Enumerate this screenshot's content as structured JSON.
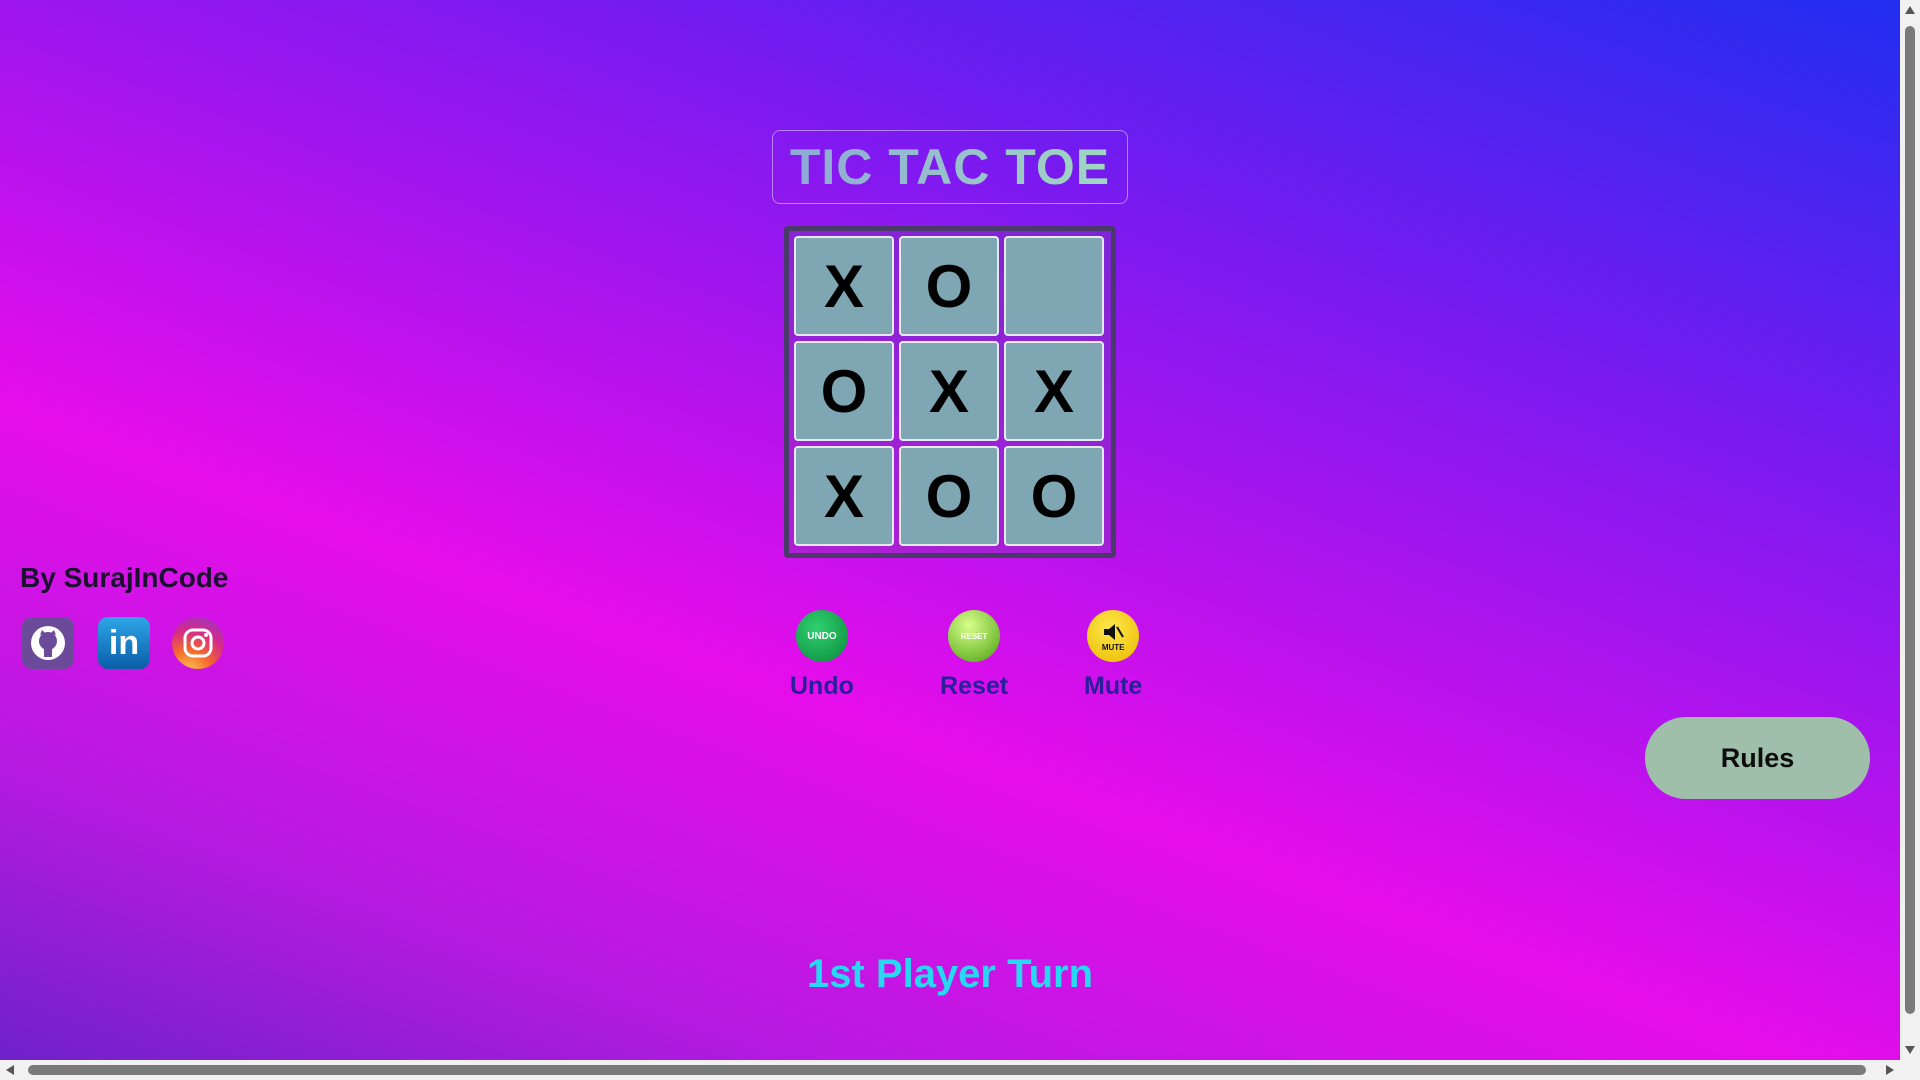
{
  "title": "TIC TAC TOE",
  "board": {
    "cells": [
      "X",
      "O",
      "",
      "O",
      "X",
      "X",
      "X",
      "O",
      "O"
    ]
  },
  "controls": {
    "undo": {
      "label": "Undo",
      "icon_text": "UNDO",
      "icon": "undo-icon",
      "color": "#0ea84a"
    },
    "reset": {
      "label": "Reset",
      "icon_text": "RESET",
      "icon": "reset-icon",
      "color": "#6fd12a"
    },
    "mute": {
      "label": "Mute",
      "icon_text": "MUTE",
      "icon": "mute-icon",
      "color": "#f5d100"
    }
  },
  "author": "By SurajInCode",
  "social": [
    {
      "name": "github",
      "icon": "github-icon"
    },
    {
      "name": "linkedin",
      "icon": "linkedin-icon",
      "text": "in"
    },
    {
      "name": "instagram",
      "icon": "instagram-icon"
    }
  ],
  "rules_label": "Rules",
  "status": "1st Player Turn"
}
